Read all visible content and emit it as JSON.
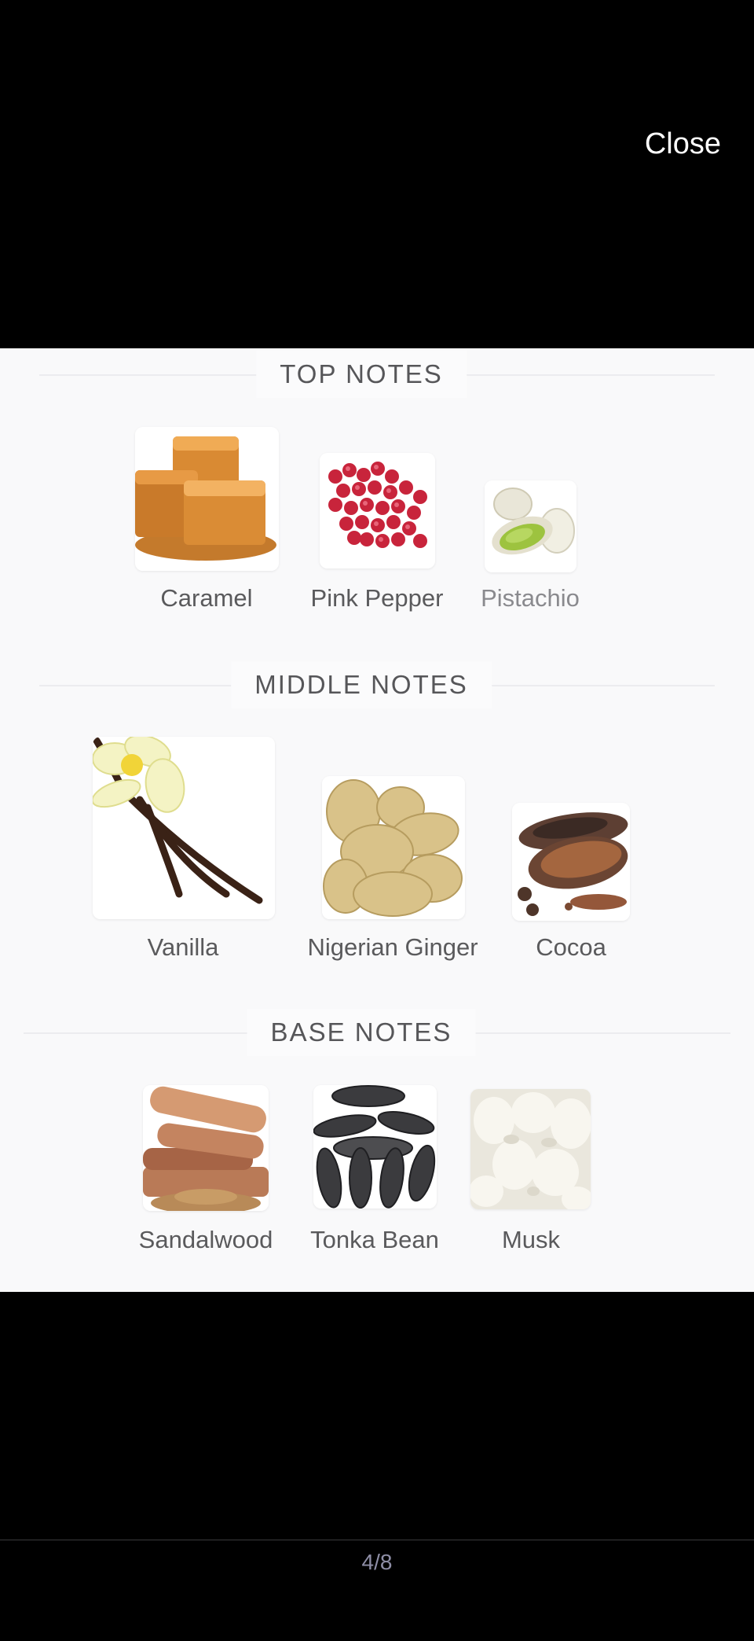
{
  "header": {
    "close_label": "Close"
  },
  "sections": [
    {
      "title": "TOP NOTES",
      "notes": [
        {
          "label": "Caramel",
          "icon": "caramel-icon"
        },
        {
          "label": "Pink Pepper",
          "icon": "pink-pepper-icon"
        },
        {
          "label": "Pistachio",
          "icon": "pistachio-icon"
        }
      ]
    },
    {
      "title": "MIDDLE NOTES",
      "notes": [
        {
          "label": "Vanilla",
          "icon": "vanilla-icon"
        },
        {
          "label": "Nigerian Ginger",
          "icon": "ginger-icon"
        },
        {
          "label": "Cocoa",
          "icon": "cocoa-icon"
        }
      ]
    },
    {
      "title": "BASE NOTES",
      "notes": [
        {
          "label": "Sandalwood",
          "icon": "sandalwood-icon"
        },
        {
          "label": "Tonka Bean",
          "icon": "tonka-bean-icon"
        },
        {
          "label": "Musk",
          "icon": "musk-icon"
        }
      ]
    }
  ],
  "pager": {
    "text": "4/8"
  }
}
